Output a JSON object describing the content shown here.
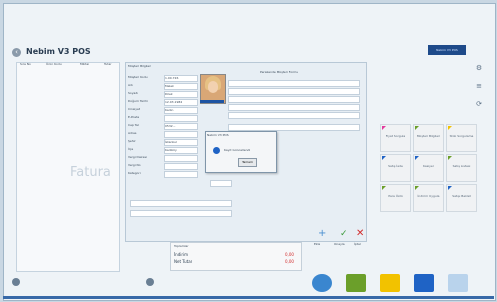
{
  "app": {
    "title": "Nebim V3 POS",
    "back_symbol": "‹",
    "top_button_label": "Nebim V3 POS"
  },
  "left_panel": {
    "columns": [
      "Sıra No",
      "Ürün Kodu",
      "Miktar",
      "Tutar"
    ],
    "watermark": "Fatura"
  },
  "form": {
    "header": "Müşteri Bilgileri",
    "section_title": "Perakende Müşteri Formu",
    "labels": [
      "Müşteri Kodu",
      "Adı",
      "Soyadı",
      "Doğum Tarihi",
      "Cinsiyet",
      "E-Posta",
      "Cep Tel",
      "Adres",
      "Şehir",
      "İlçe",
      "Vergi Dairesi",
      "Vergi No",
      "Kategori"
    ],
    "values": [
      "1.00.726",
      "Melek",
      "Dilek",
      "12.03.1984",
      "Kadın",
      "",
      "0532...",
      "",
      "İstanbul",
      "Kadıköy",
      "",
      "",
      ""
    ]
  },
  "dialog": {
    "title": "Nebim V3 POS",
    "message": "Kayıt Güncellendi",
    "ok_label": "Tamam"
  },
  "tiles": [
    {
      "label": "Fiyat Sorgula",
      "accent": "#e23b9e"
    },
    {
      "label": "Müşteri Bilgileri",
      "accent": "#6b9f2a"
    },
    {
      "label": "Stok Sorgulama",
      "accent": "#f2c200"
    },
    {
      "label": "Satış İade",
      "accent": "#1f63c5"
    },
    {
      "label": "Kasiyer",
      "accent": "#1f63c5"
    },
    {
      "label": "Satış Listesi",
      "accent": "#6b9f2a"
    },
    {
      "label": "Para Üstü",
      "accent": "#6b9f2a"
    },
    {
      "label": "İndirim Uygula",
      "accent": "#6b9f2a"
    },
    {
      "label": "Satışı Beklet",
      "accent": "#1f63c5"
    }
  ],
  "totals": {
    "header": "Toplamlar",
    "label1": "İndirim",
    "value1": "0,00",
    "label2": "Net Tutar",
    "value2": "0,00"
  },
  "actions": {
    "add": "+",
    "ok": "✓",
    "cancel": "✕",
    "add_label": "Ekle",
    "ok_label": "Onayla",
    "cancel_label": "İptal"
  },
  "side_icons": [
    "⚙",
    "≡",
    "⟳"
  ],
  "bottom_icons": [
    {
      "name": "power",
      "color": "#3a86cf"
    },
    {
      "name": "receipt",
      "color": "#6b9f2a"
    },
    {
      "name": "cash",
      "color": "#f2c200"
    },
    {
      "name": "card",
      "color": "#1f63c5"
    },
    {
      "name": "calendar",
      "color": "#b9d3ec"
    }
  ]
}
